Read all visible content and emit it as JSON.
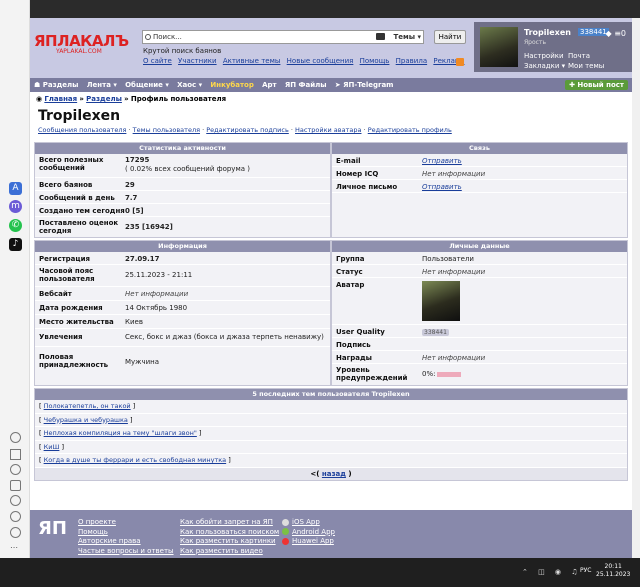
{
  "header": {
    "logo_text": "ЯПЛАКАЛЪ",
    "logo_sub": "YAPLAKAL.COM",
    "search_placeholder": "Поиск...",
    "search_scope": "Темы ▾",
    "find_button": "Найти",
    "tagline": "Крутой поиск баянов",
    "links": [
      "О сайте",
      "Участники",
      "Активные темы",
      "Новые сообщения",
      "Помощь",
      "Правила",
      "Реклама"
    ]
  },
  "user": {
    "name": "Tropilexen",
    "id": "338441",
    "status": "Ярость",
    "menu_icons": "◆  ≡0",
    "links_row1": [
      "Настройки",
      "Почта"
    ],
    "links_row2": [
      "Закладки ▾",
      "Мои темы"
    ]
  },
  "nav": {
    "items": [
      "☗  Разделы",
      "Лента ▾",
      "Общение ▾",
      "Хаос ▾"
    ],
    "highlight": "Инкубатор",
    "items2": [
      "Арт",
      "ЯП Файлы",
      "➤ ЯП-Telegram"
    ],
    "new_post": "✚ Новый пост"
  },
  "breadcrumb": {
    "home": "Главная",
    "section": "Разделы",
    "current": "Профиль пользователя",
    "sep": "»"
  },
  "profile": {
    "title": "Tropilexen",
    "links": [
      "Сообщения пользователя",
      "Темы пользователя",
      "Редактировать подпись",
      "Настройки аватара",
      "Редактировать профиль"
    ],
    "sep": "·"
  },
  "stats": {
    "heading": "Статистика активности",
    "rows": [
      {
        "label": "Всего полезных сообщений",
        "value": "17295",
        "sub": "( 0.02% всех сообщений форума )"
      },
      {
        "label": "Всего баянов",
        "value": "29"
      },
      {
        "label": "Сообщений в день",
        "value": "7.7"
      },
      {
        "label": "Создано тем сегодня",
        "value": "0 [5]"
      },
      {
        "label": "Поставлено оценок сегодня",
        "value": "235 [16942]"
      }
    ]
  },
  "contact": {
    "heading": "Связь",
    "rows": [
      {
        "label": "E-mail",
        "value": "Отправить"
      },
      {
        "label": "Номер ICQ",
        "value": "Нет информации"
      },
      {
        "label": "Личное письмо",
        "value": "Отправить"
      }
    ]
  },
  "info": {
    "heading": "Информация",
    "rows": [
      {
        "label": "Регистрация",
        "value": "27.09.17"
      },
      {
        "label": "Часовой пояс пользователя",
        "value": "25.11.2023 - 21:11"
      },
      {
        "label": "Вебсайт",
        "value": "Нет информации"
      },
      {
        "label": "Дата рождения",
        "value": "14 Октябрь 1980"
      },
      {
        "label": "Место жительства",
        "value": "Киев"
      },
      {
        "label": "Увлечения",
        "value": "Секс, бокс и джаз (бокса и джаза терпеть ненавижу)"
      },
      {
        "label": "Половая принадлежность",
        "value": "Мужчина"
      }
    ]
  },
  "personal": {
    "heading": "Личные данные",
    "rows": [
      {
        "label": "Группа",
        "value": "Пользователи"
      },
      {
        "label": "Статус",
        "value": "Нет информации"
      },
      {
        "label": "Аватар",
        "value": ""
      },
      {
        "label": "User Quality",
        "value": "338441"
      },
      {
        "label": "Подпись",
        "value": ""
      },
      {
        "label": "Награды",
        "value": "Нет информации"
      },
      {
        "label": "Уровень предупреждений",
        "value": "0%:"
      }
    ]
  },
  "topics": {
    "heading": "5 последних тем пользователя Tropilexen",
    "items": [
      "Полокатепетль, он такой",
      "Чебурашка и чебурашка",
      "Неплохая компиляция на тему \"шлаги звон\"",
      "КиШ",
      "Когда в душе ты феррари и есть свободная минутка"
    ],
    "back_prefix": "<(",
    "back_label": "назад",
    "back_suffix": ")"
  },
  "footer": {
    "logo": "ЯП",
    "col1": [
      "О проекте",
      "Помощь",
      "Авторские права",
      "Частые вопросы и ответы"
    ],
    "col2": [
      "Как обойти запрет на ЯП",
      "Как пользоваться поиском",
      "Как разместить картинки",
      "Как разместить видео"
    ],
    "col3": [
      "iOS App",
      "Android App",
      "Huawei App"
    ]
  },
  "taskbar": {
    "lang": "РУС",
    "time": "20:11",
    "date": "25.11.2023",
    "tray": "⌃ ◫ ◉ ♫"
  },
  "colors": {
    "header_bg": "#c8c9e3",
    "nav_bg": "#7a7b9e",
    "panel_head": "#8f90ae",
    "link": "#1a3e9a",
    "incubator": "#ffd84a",
    "new_post": "#5b9b3a"
  }
}
